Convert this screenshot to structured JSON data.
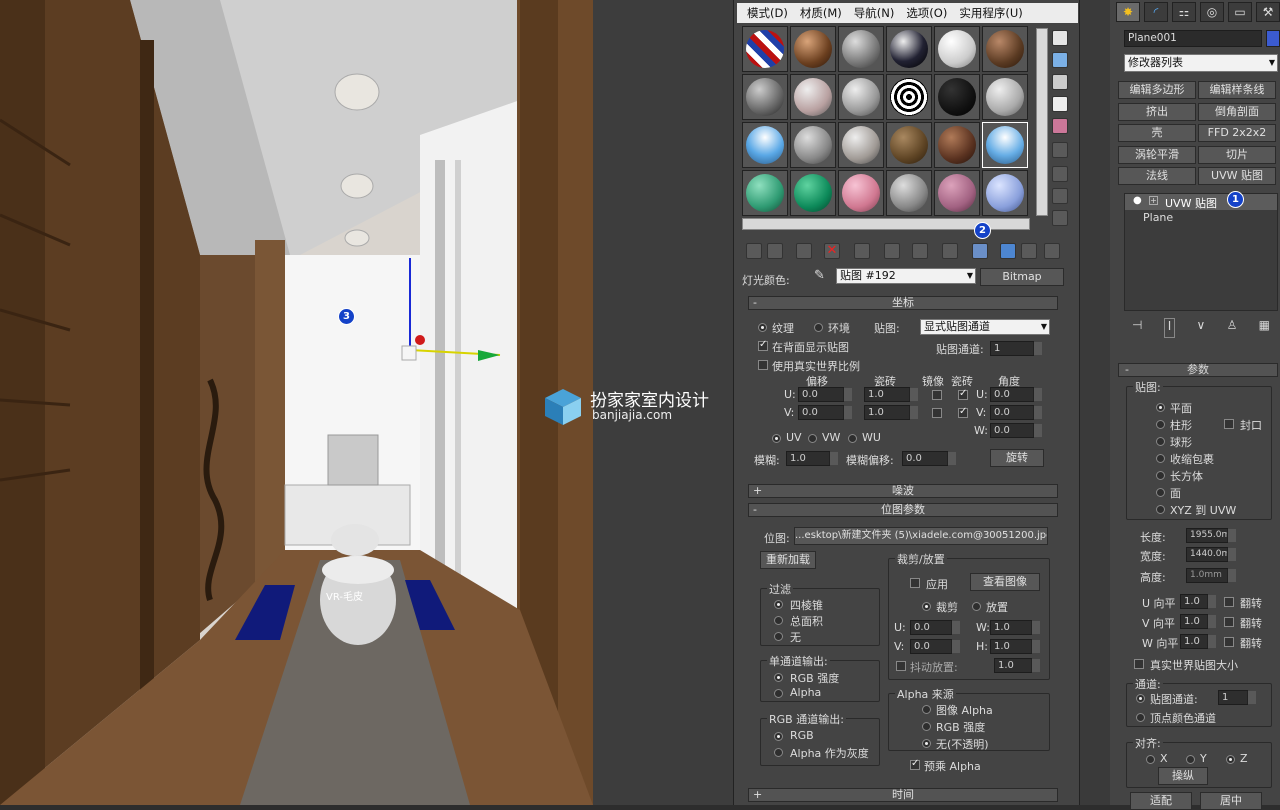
{
  "material_editor": {
    "menu": [
      "模式(D)",
      "材质(M)",
      "导航(N)",
      "选项(O)",
      "实用程序(U)"
    ],
    "light_color_label": "灯光颜色:",
    "map_name": "贴图 #192",
    "map_type": "Bitmap",
    "coords": {
      "title": "坐标",
      "texture": "纹理",
      "environ": "环境",
      "mapping_label": "贴图:",
      "mapping_value": "显式贴图通道",
      "show_back": "在背面显示贴图",
      "map_channel_label": "贴图通道:",
      "map_channel": "1",
      "real_world": "使用真实世界比例",
      "offset": "偏移",
      "tiling": "瓷砖",
      "mirror": "镜像",
      "tile": "瓷砖",
      "angle": "角度",
      "u_label": "U:",
      "v_label": "V:",
      "w_label": "W:",
      "u_offset": "0.0",
      "v_offset": "0.0",
      "u_tiling": "1.0",
      "v_tiling": "1.0",
      "u_angle": "0.0",
      "v_angle": "0.0",
      "w_angle": "0.0",
      "uv": "UV",
      "vw": "VW",
      "wu": "WU",
      "blur_label": "模糊:",
      "blur": "1.0",
      "blur_off_label": "模糊偏移:",
      "blur_off": "0.0",
      "rotate": "旋转"
    },
    "noise_title": "噪波",
    "bitmap": {
      "title": "位图参数",
      "bitmap_label": "位图:",
      "path": "...esktop\\新建文件夹 (5)\\xiadele.com@30051200.jpg",
      "reload": "重新加载",
      "crop_group": "裁剪/放置",
      "apply": "应用",
      "view_image": "查看图像",
      "crop": "裁剪",
      "place": "放置",
      "u": "0.0",
      "v": "0.0",
      "w": "1.0",
      "h": "1.0",
      "h_label": "H:",
      "jitter": "抖动放置:",
      "jitter_val": "1.0",
      "filter_group": "过滤",
      "f1": "四棱锥",
      "f2": "总面积",
      "f3": "无",
      "mono_group": "单通道输出:",
      "m1": "RGB 强度",
      "m2": "Alpha",
      "rgb_group": "RGB 通道输出:",
      "r1": "RGB",
      "r2": "Alpha 作为灰度",
      "alpha_group": "Alpha 来源",
      "a1": "图像 Alpha",
      "a2": "RGB 强度",
      "a3": "无(不透明)",
      "premult": "预乘 Alpha"
    },
    "time_title": "时间"
  },
  "watermark": {
    "title": "扮家家室内设计",
    "url": "banjiajia.com"
  },
  "viewport": {
    "label": "VR-毛皮",
    "callout3": "3"
  },
  "callout2": "2",
  "command_panel": {
    "object_name": "Plane001",
    "modifier_list": "修改器列表",
    "buttons": [
      "编辑多边形",
      "编辑样条线",
      "挤出",
      "倒角剖面",
      "壳",
      "FFD 2x2x2",
      "涡轮平滑",
      "切片",
      "法线",
      "UVW 贴图"
    ],
    "stack": [
      "UVW 贴图",
      "Plane"
    ],
    "callout1": "1",
    "params": {
      "title": "参数",
      "mapping_group": "贴图:",
      "opts": [
        "平面",
        "柱形",
        "球形",
        "收缩包裹",
        "长方体",
        "面",
        "XYZ 到 UVW"
      ],
      "cap": "封口",
      "length_label": "长度:",
      "length": "1955.0m",
      "width_label": "宽度:",
      "width": "1440.0m",
      "height_label": "高度:",
      "height": "1.0mm",
      "utile_label": "U 向平",
      "utile": "1.0",
      "vtile_label": "V 向平",
      "vtile": "1.0",
      "wtile_label": "W 向平",
      "wtile": "1.0",
      "flip": "翻转",
      "real_world": "真实世界贴图大小",
      "channel_group": "通道:",
      "map_channel": "贴图通道:",
      "map_channel_val": "1",
      "vertex_color": "顶点颜色通道",
      "align_group": "对齐:",
      "x": "X",
      "y": "Y",
      "z": "Z",
      "manip": "操纵",
      "fit": "适配",
      "center": "居中"
    }
  }
}
